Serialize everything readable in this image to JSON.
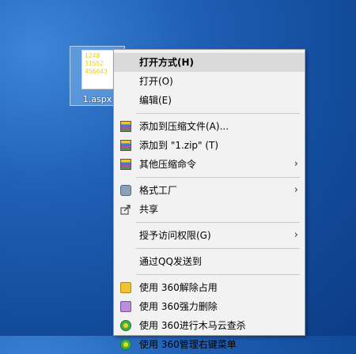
{
  "desktop": {
    "file": {
      "name": "1.aspx",
      "preview_lines": [
        "1248",
        "31552",
        "456643"
      ]
    }
  },
  "context_menu": {
    "items": [
      {
        "label": "打开方式(H)",
        "bold": true,
        "highlighted": true,
        "icon": null,
        "submenu": false
      },
      {
        "label": "打开(O)",
        "icon": null,
        "submenu": false
      },
      {
        "label": "编辑(E)",
        "icon": null,
        "submenu": false
      },
      {
        "label": "添加到压缩文件(A)...",
        "icon": "winrar-icon",
        "submenu": false
      },
      {
        "label": "添加到 \"1.zip\" (T)",
        "icon": "winrar-icon",
        "submenu": false
      },
      {
        "label": "其他压缩命令",
        "icon": "winrar-icon",
        "submenu": true
      },
      {
        "label": "格式工厂",
        "icon": "format-factory-icon",
        "submenu": true
      },
      {
        "label": "共享",
        "icon": "share-icon",
        "submenu": false
      },
      {
        "label": "授予访问权限(G)",
        "icon": null,
        "submenu": true
      },
      {
        "label": "通过QQ发送到",
        "icon": null,
        "submenu": false
      },
      {
        "label": "使用 360解除占用",
        "icon": "360-unlock-icon",
        "submenu": false
      },
      {
        "label": "使用 360强力删除",
        "icon": "360-shred-icon",
        "submenu": false
      },
      {
        "label": "使用 360进行木马云查杀",
        "icon": "360-scan-icon",
        "submenu": false
      },
      {
        "label": "使用 360管理右键菜单",
        "icon": "360-manage-icon",
        "submenu": false
      }
    ],
    "arrow_glyph": "›"
  }
}
